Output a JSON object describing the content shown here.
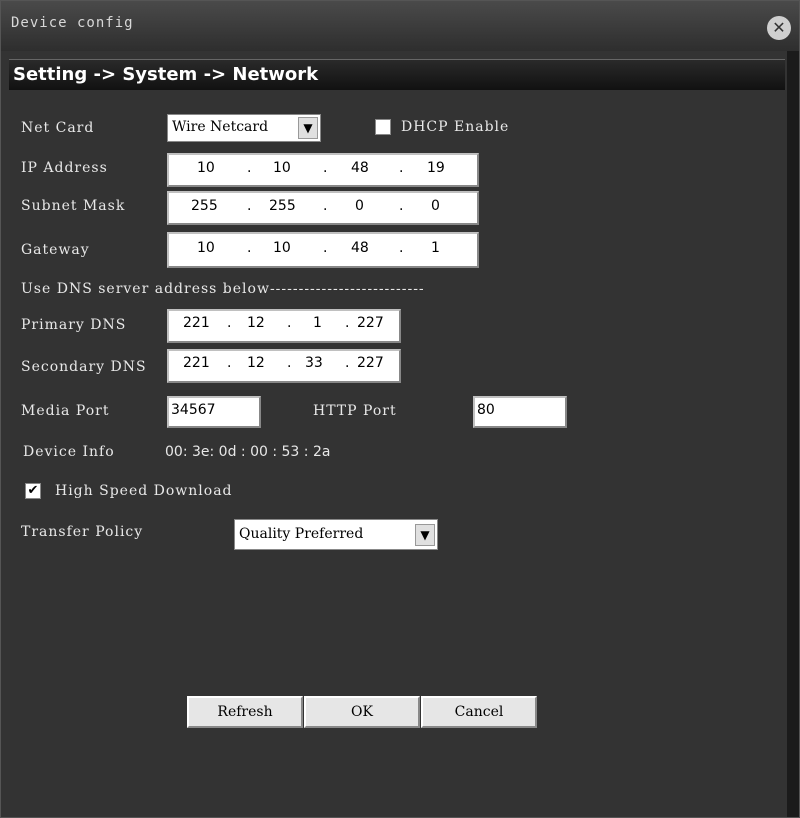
{
  "window": {
    "title": "Device config"
  },
  "breadcrumb": "Setting -> System -> Network",
  "net_card": {
    "label": "Net Card",
    "value": "Wire Netcard"
  },
  "dhcp": {
    "label": "DHCP Enable",
    "checked": false
  },
  "ip_address": {
    "label": "IP Address",
    "octets": [
      "10",
      "10",
      "48",
      "19"
    ]
  },
  "subnet_mask": {
    "label": "Subnet Mask",
    "octets": [
      "255",
      "255",
      "0",
      "0"
    ]
  },
  "gateway": {
    "label": "Gateway",
    "octets": [
      "10",
      "10",
      "48",
      "1"
    ]
  },
  "dns_heading": "Use DNS server address below---------------------------",
  "primary_dns": {
    "label": "Primary DNS",
    "octets": [
      "221",
      "12",
      "1",
      "227"
    ]
  },
  "secondary_dns": {
    "label": "Secondary DNS",
    "octets": [
      "221",
      "12",
      "33",
      "227"
    ]
  },
  "media_port": {
    "label": "Media Port",
    "value": "34567"
  },
  "http_port": {
    "label": "HTTP Port",
    "value": "80"
  },
  "device_info": {
    "label": "Device Info",
    "value": "00: 3e: 0d : 00 : 53 : 2a"
  },
  "high_speed": {
    "label": "High Speed Download",
    "checked": true
  },
  "transfer_policy": {
    "label": "Transfer Policy",
    "value": "Quality Preferred"
  },
  "buttons": {
    "refresh": "Refresh",
    "ok": "OK",
    "cancel": "Cancel"
  }
}
